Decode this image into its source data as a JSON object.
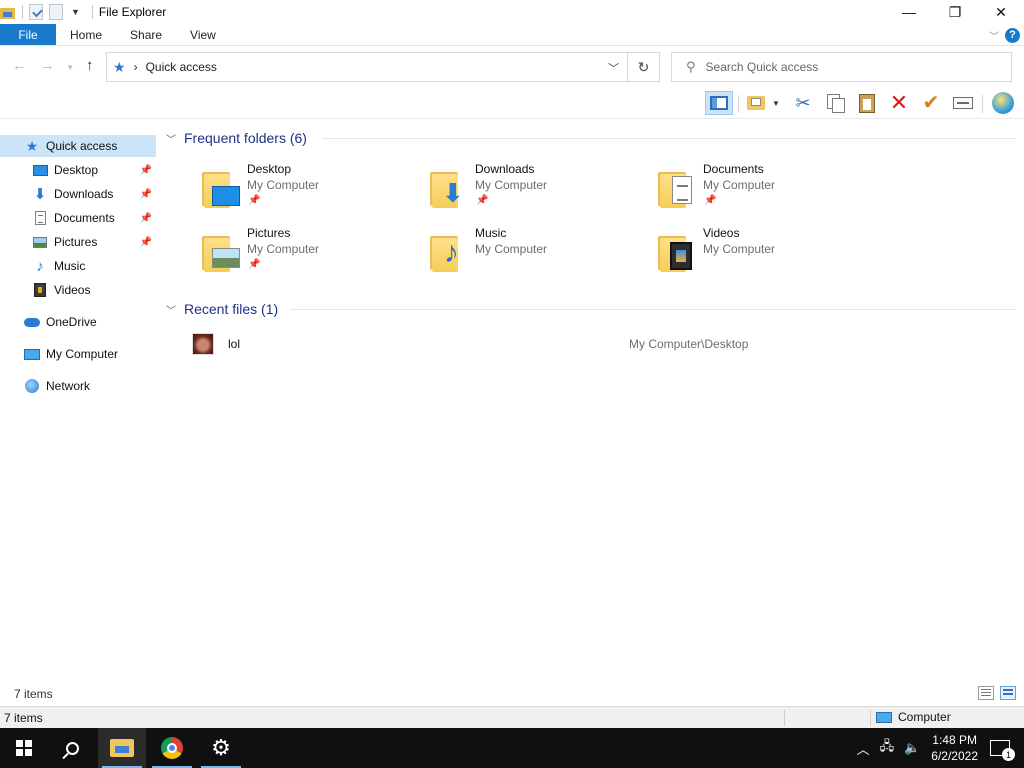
{
  "window": {
    "title": "File Explorer",
    "controls": {
      "minimize": "—",
      "maximize": "❐",
      "close": "✕"
    }
  },
  "ribbon": {
    "tabs": [
      {
        "label": "File"
      },
      {
        "label": "Home"
      },
      {
        "label": "Share"
      },
      {
        "label": "View"
      }
    ],
    "help": "?"
  },
  "address": {
    "location": "Quick access",
    "search_placeholder": "Search Quick access"
  },
  "toolbar": {
    "buttons": [
      "navigation-pane",
      "new-folder",
      "cut",
      "copy",
      "paste",
      "delete",
      "check",
      "rename",
      "web"
    ]
  },
  "sidebar": {
    "items": [
      {
        "label": "Quick access",
        "icon": "star-icon",
        "selected": true
      },
      {
        "label": "Desktop",
        "icon": "desktop-icon",
        "pinned": true
      },
      {
        "label": "Downloads",
        "icon": "download-icon",
        "pinned": true
      },
      {
        "label": "Documents",
        "icon": "document-icon",
        "pinned": true
      },
      {
        "label": "Pictures",
        "icon": "picture-icon",
        "pinned": true
      },
      {
        "label": "Music",
        "icon": "music-icon"
      },
      {
        "label": "Videos",
        "icon": "video-icon"
      },
      {
        "label": "OneDrive",
        "icon": "cloud-icon"
      },
      {
        "label": "My Computer",
        "icon": "computer-icon"
      },
      {
        "label": "Network",
        "icon": "network-icon"
      }
    ]
  },
  "frequent": {
    "header": "Frequent folders (6)",
    "folders": [
      {
        "name": "Desktop",
        "location": "My Computer",
        "pinned": true
      },
      {
        "name": "Downloads",
        "location": "My Computer",
        "pinned": true
      },
      {
        "name": "Documents",
        "location": "My Computer",
        "pinned": true
      },
      {
        "name": "Pictures",
        "location": "My Computer",
        "pinned": true
      },
      {
        "name": "Music",
        "location": "My Computer",
        "pinned": false
      },
      {
        "name": "Videos",
        "location": "My Computer",
        "pinned": false
      }
    ]
  },
  "recent": {
    "header": "Recent files (1)",
    "files": [
      {
        "name": "lol",
        "path": "My Computer\\Desktop"
      }
    ]
  },
  "status": {
    "items_count": "7 items",
    "items_count_bottom": "7 items",
    "zone": "Computer"
  },
  "taskbar": {
    "time": "1:48 PM",
    "date": "6/2/2022",
    "notifications": "1"
  },
  "colors": {
    "accent": "#1979ca",
    "selection": "#cce4f7",
    "group_header": "#1e3287"
  }
}
